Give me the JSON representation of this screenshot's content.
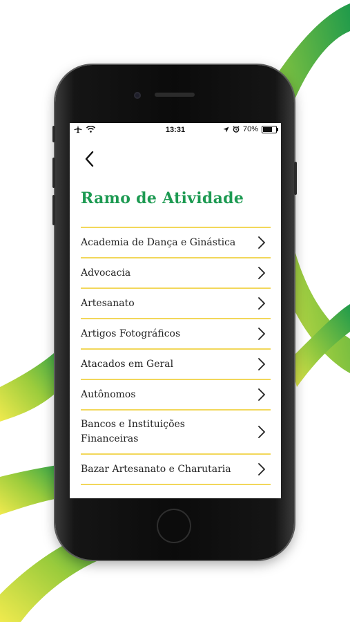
{
  "theme": {
    "accent": "#1d9a52",
    "divider": "#f2d75a",
    "wave_green": "#1f9a4b",
    "wave_yellow": "#e4e34a"
  },
  "status_bar": {
    "icons": [
      "airplane-icon",
      "wifi-icon"
    ],
    "time": "13:31",
    "right_icons": [
      "location-icon",
      "alarm-icon"
    ],
    "battery_text": "70%",
    "battery_level": 0.7
  },
  "header": {
    "back_icon": "chevron-left-icon"
  },
  "page": {
    "title": "Ramo de Atividade"
  },
  "list": {
    "items": [
      {
        "label": "Academia de Dança e Ginástica"
      },
      {
        "label": "Advocacia"
      },
      {
        "label": "Artesanato"
      },
      {
        "label": "Artigos Fotográficos"
      },
      {
        "label": "Atacados em Geral"
      },
      {
        "label": "Autônomos"
      },
      {
        "label": "Bancos e Instituições Financeiras"
      },
      {
        "label": "Bazar Artesanato e Charutaria"
      }
    ],
    "chevron_icon": "chevron-right-icon"
  }
}
